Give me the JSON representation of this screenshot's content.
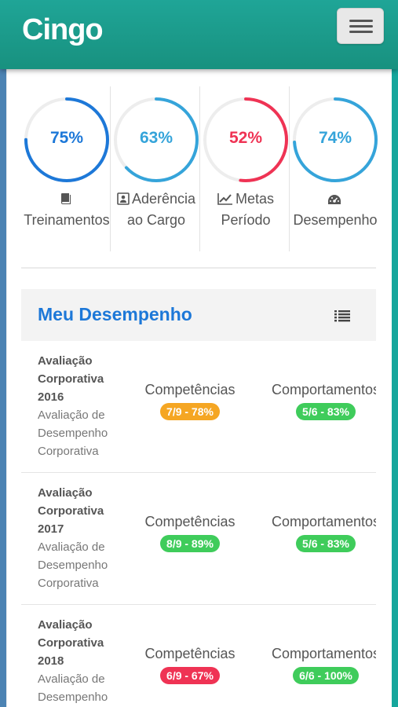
{
  "app": {
    "brand": "Cingo"
  },
  "stats": [
    {
      "value_text": "75%",
      "percent": 75,
      "color": "#1d78d8",
      "track": "#ededed",
      "icon": "book-icon",
      "label_line1": "Treinamentos",
      "label_line2": ""
    },
    {
      "value_text": "63%",
      "percent": 63,
      "color": "#35a4da",
      "track": "#ededed",
      "icon": "id-card-icon",
      "label_line1": "Aderência",
      "label_line2": "ao Cargo"
    },
    {
      "value_text": "52%",
      "percent": 52,
      "color": "#ef3354",
      "track": "#ededed",
      "icon": "line-chart-icon",
      "label_line1": "Metas",
      "label_line2": "Período"
    },
    {
      "value_text": "74%",
      "percent": 74,
      "color": "#35a4da",
      "track": "#ededed",
      "icon": "dashboard-icon",
      "label_line1": "Desempenho",
      "label_line2": ""
    }
  ],
  "section": {
    "title": "Meu Desempenho",
    "icon": "list-icon"
  },
  "evaluations": [
    {
      "name": "Avaliação Corporativa 2016",
      "subtitle": "Avaliação de Desempenho Corporativa",
      "competencias_label": "Competências",
      "competencias_badge": "7/9 - 78%",
      "competencias_color": "#f5a623",
      "comportamentos_label": "Comportamentos",
      "comportamentos_badge": "5/6 - 83%",
      "comportamentos_color": "#3fcc5b"
    },
    {
      "name": "Avaliação Corporativa 2017",
      "subtitle": "Avaliação de Desempenho Corporativa",
      "competencias_label": "Competências",
      "competencias_badge": "8/9 - 89%",
      "competencias_color": "#3fcc5b",
      "comportamentos_label": "Comportamentos",
      "comportamentos_badge": "5/6 - 83%",
      "comportamentos_color": "#3fcc5b"
    },
    {
      "name": "Avaliação Corporativa 2018",
      "subtitle": "Avaliação de Desempenho Corporativa",
      "competencias_label": "Competências",
      "competencias_badge": "6/9 - 67%",
      "competencias_color": "#ef3354",
      "comportamentos_label": "Comportamentos",
      "comportamentos_badge": "6/6 - 100%",
      "comportamentos_color": "#3fcc5b"
    }
  ]
}
